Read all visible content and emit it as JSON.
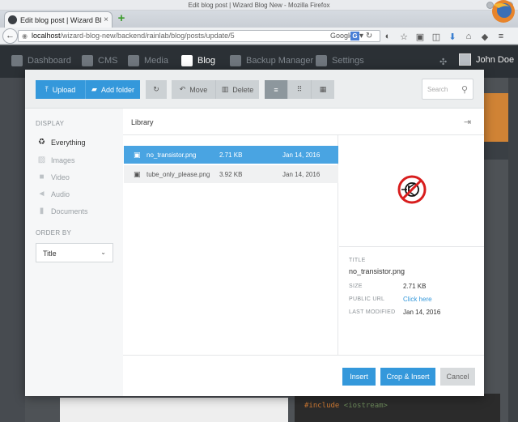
{
  "window": {
    "title": "Edit blog post | Wizard Blog New - Mozilla Firefox"
  },
  "tab": {
    "title": "Edit blog post | Wizard Bl...",
    "new_tab": "+"
  },
  "nav": {
    "url_host": "localhost",
    "url_path": "/wizard-blog-new/backend/rainlab/blog/posts/update/5",
    "search_engine": "Google",
    "back_icon": "back-arrow-icon"
  },
  "app": {
    "menu": [
      {
        "label": "Dashboard",
        "icon": "dashboard-icon"
      },
      {
        "label": "CMS",
        "icon": "wand-icon"
      },
      {
        "label": "Media",
        "icon": "folder-icon"
      },
      {
        "label": "Blog",
        "icon": "pencil-icon"
      },
      {
        "label": "Backup Manager",
        "icon": "database-icon"
      },
      {
        "label": "Settings",
        "icon": "gear-icon"
      }
    ],
    "active": "Blog",
    "user": "John Doe"
  },
  "toolbar": {
    "upload": "Upload",
    "add_folder": "Add folder",
    "move": "Move",
    "delete": "Delete",
    "search_placeholder": "Search"
  },
  "sidebar": {
    "display_header": "DISPLAY",
    "filters": [
      {
        "label": "Everything",
        "icon": "recycle-icon",
        "selected": true
      },
      {
        "label": "Images",
        "icon": "image-icon",
        "selected": false
      },
      {
        "label": "Video",
        "icon": "video-icon",
        "selected": false
      },
      {
        "label": "Audio",
        "icon": "audio-icon",
        "selected": false
      },
      {
        "label": "Documents",
        "icon": "document-icon",
        "selected": false
      }
    ],
    "order_header": "ORDER BY",
    "order_value": "Title"
  },
  "library": {
    "title": "Library",
    "files": [
      {
        "name": "no_transistor.png",
        "size": "2.71 KB",
        "date": "Jan 14, 2016",
        "selected": true
      },
      {
        "name": "tube_only_please.png",
        "size": "3.92 KB",
        "date": "Jan 14, 2016",
        "selected": false
      }
    ]
  },
  "details": {
    "title_label": "TITLE",
    "title": "no_transistor.png",
    "size_label": "SIZE",
    "size": "2.71 KB",
    "url_label": "PUBLIC URL",
    "url": "Click here",
    "modified_label": "LAST MODIFIED",
    "modified": "Jan 14, 2016"
  },
  "footer": {
    "insert": "Insert",
    "crop_insert": "Crop & Insert",
    "cancel": "Cancel"
  },
  "background": {
    "code_keyword": "#include",
    "code_lib": "<iostream>"
  },
  "colors": {
    "accent": "#3498db",
    "selection": "#49a4e2",
    "appbar": "#2b3035"
  }
}
